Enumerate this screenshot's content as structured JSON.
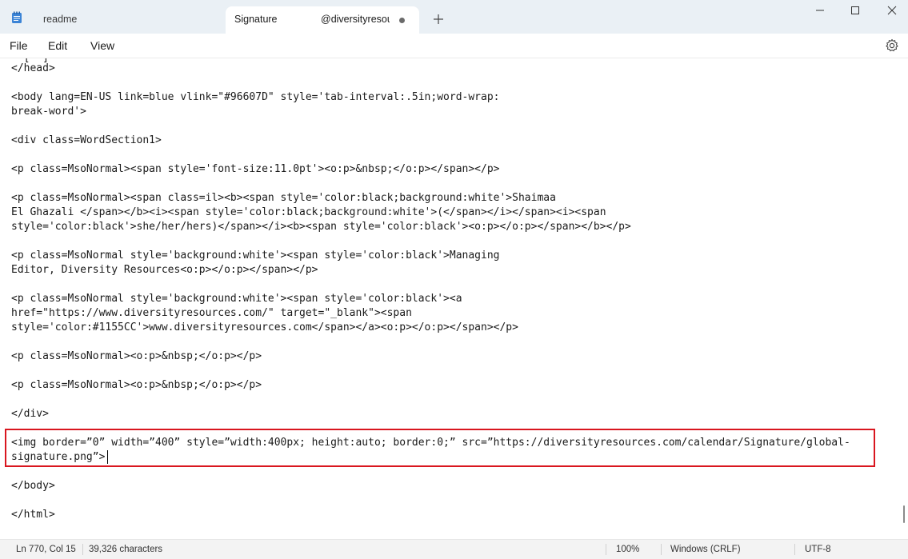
{
  "tabs": [
    {
      "label": "readme",
      "active": false
    },
    {
      "label": "Signature",
      "label2": "@diversityresources.com",
      "active": true,
      "unsaved": true
    }
  ],
  "menu": {
    "file": "File",
    "edit": "Edit",
    "view": "View"
  },
  "editor": {
    "lines": [
      "  [  ]",
      "</head>",
      "",
      "<body lang=EN-US link=blue vlink=\"#96607D\" style='tab-interval:.5in;word-wrap:",
      "break-word'>",
      "",
      "<div class=WordSection1>",
      "",
      "<p class=MsoNormal><span style='font-size:11.0pt'><o:p>&nbsp;</o:p></span></p>",
      "",
      "<p class=MsoNormal><span class=il><b><span style='color:black;background:white'>Shaimaa",
      "El Ghazali </span></b><i><span style='color:black;background:white'>(</span></i></span><i><span",
      "style='color:black'>she/her/hers)</span></i><b><span style='color:black'><o:p></o:p></span></b></p>",
      "",
      "<p class=MsoNormal style='background:white'><span style='color:black'>Managing",
      "Editor, Diversity Resources<o:p></o:p></span></p>",
      "",
      "<p class=MsoNormal style='background:white'><span style='color:black'><a",
      "href=\"https://www.diversityresources.com/\" target=\"_blank\"><span",
      "style='color:#1155CC'>www.diversityresources.com</span></a><o:p></o:p></span></p>",
      "",
      "<p class=MsoNormal><o:p>&nbsp;</o:p></p>",
      "",
      "<p class=MsoNormal><o:p>&nbsp;</o:p></p>",
      "",
      "</div>",
      "",
      "<img border=”0” width=”400” style=”width:400px; height:auto; border:0;” src=”https://diversityresources.com/calendar/Signature/global-",
      "signature.png”>",
      "",
      "</body>",
      "",
      "</html>"
    ]
  },
  "status": {
    "position": "Ln 770, Col 15",
    "characters": "39,326 characters",
    "zoom": "100%",
    "line_ending": "Windows (CRLF)",
    "encoding": "UTF-8"
  },
  "colors": {
    "titlebar": "#eaf0f5",
    "highlight": "#d9161f"
  }
}
